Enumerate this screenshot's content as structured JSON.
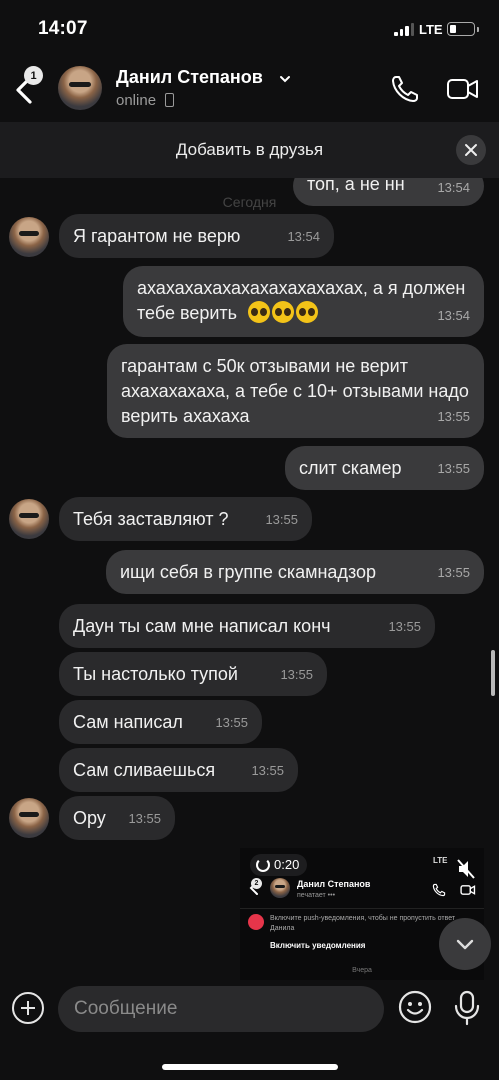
{
  "status_bar": {
    "time": "14:07",
    "network": "LTE",
    "battery_level": 0.2
  },
  "header": {
    "back_badge": "1",
    "contact_name": "Данил Степанов",
    "contact_status": "online"
  },
  "banner": {
    "add_friend_label": "Добавить в друзья"
  },
  "chat": {
    "date_separator": "Сегодня",
    "messages": [
      {
        "dir": "out",
        "text": "топ, а не нн",
        "time": "13:54"
      },
      {
        "dir": "in",
        "text": "Я гарантом  не верю",
        "time": "13:54"
      },
      {
        "dir": "out",
        "text": "ахахахахахахахахахахахах, а я должен тебе верить",
        "time": "13:54",
        "emoji": "pleading-face x3"
      },
      {
        "dir": "out",
        "text": "гарантам с 50к отзывами не верит ахахахахаха, а тебе с 10+ отзывами надо верить ахахаха",
        "time": "13:55"
      },
      {
        "dir": "out",
        "text": "слит скамер",
        "time": "13:55"
      },
      {
        "dir": "in",
        "text": "Тебя заставляют ?",
        "time": "13:55"
      },
      {
        "dir": "out",
        "text": "ищи себя в группе скамнадзор",
        "time": "13:55"
      },
      {
        "dir": "in",
        "text": "Даун ты сам мне написал конч",
        "time": "13:55"
      },
      {
        "dir": "in",
        "text": "Ты настолько тупой",
        "time": "13:55"
      },
      {
        "dir": "in",
        "text": "Сам написал",
        "time": "13:55"
      },
      {
        "dir": "in",
        "text": "Сам сливаешься",
        "time": "13:55"
      },
      {
        "dir": "in",
        "text": "Ору",
        "time": "13:55"
      }
    ]
  },
  "video_preview": {
    "timer": "0:20",
    "status": "LTE",
    "back_badge": "2",
    "contact_name": "Данил Степанов",
    "contact_sub": "печатает •••",
    "push_text": "Включите push-уведомления, чтобы не пропустить ответ Данила",
    "enable_label": "Включить уведомления",
    "date": "Вчера"
  },
  "composer": {
    "placeholder": "Сообщение"
  },
  "icons": {
    "back": "chevron-left-icon",
    "call": "phone-icon",
    "video": "video-camera-icon",
    "close": "close-icon",
    "scroll_down": "chevron-down-icon",
    "add": "plus-circle-icon",
    "emoji": "smiley-icon",
    "mic": "microphone-icon"
  },
  "colors": {
    "background": "#0f0f10",
    "incoming_bubble": "#2a2a2c",
    "outgoing_bubble": "#3a3a3c",
    "accent_badge": "#e6354a"
  }
}
